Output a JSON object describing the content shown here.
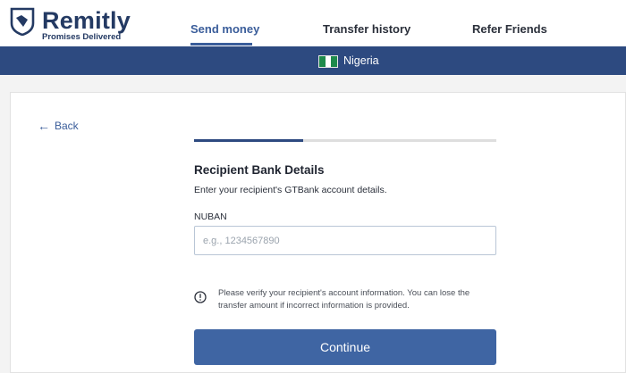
{
  "brand": {
    "name": "Remitly",
    "tagline": "Promises Delivered",
    "color": "#243a63"
  },
  "nav": {
    "tabs": [
      {
        "label": "Send money",
        "active": true
      },
      {
        "label": "Transfer history",
        "active": false
      },
      {
        "label": "Refer Friends",
        "active": false
      }
    ]
  },
  "country_bar": {
    "country": "Nigeria",
    "flag_icon": "nigeria-flag-icon",
    "flag_colors": [
      "#1e8a4c",
      "#ffffff",
      "#1e8a4c"
    ],
    "background": "#2d4a80"
  },
  "form": {
    "back_label": "Back",
    "progress": 0.36,
    "title": "Recipient Bank Details",
    "subtitle": "Enter your recipient's GTBank account details.",
    "field_label": "NUBAN",
    "field_value": "",
    "field_placeholder": "e.g., 1234567890",
    "info_icon": "info-circle-icon",
    "info_text": "Please verify your recipient's account information. You can lose the transfer amount if incorrect information is provided.",
    "continue_label": "Continue"
  },
  "colors": {
    "accent": "#3a5d9a",
    "button": "#3f65a3"
  }
}
